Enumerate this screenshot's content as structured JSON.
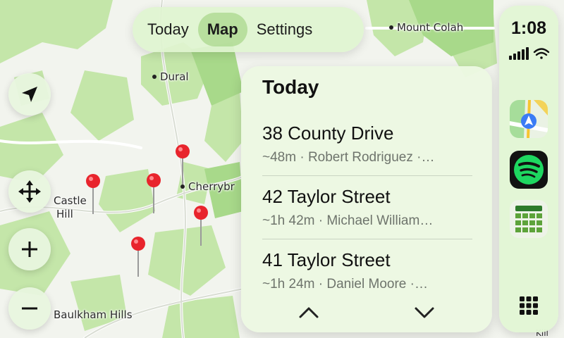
{
  "tabs": {
    "items": [
      {
        "label": "Today"
      },
      {
        "label": "Map"
      },
      {
        "label": "Settings"
      }
    ],
    "active": "Map"
  },
  "map": {
    "places": [
      "Mount Colah",
      "Dural",
      "Cherrybr",
      "Castle",
      "Hill",
      "Baulkham Hills",
      "Kill"
    ],
    "pin_color": "#e8242c",
    "pin_count": 6
  },
  "controls": {
    "locate_icon": "location-arrow-icon",
    "pan_icon": "move-arrows-icon",
    "zoom_in_icon": "plus-icon",
    "zoom_out_icon": "minus-icon"
  },
  "panel": {
    "title": "Today",
    "items": [
      {
        "title": "38 County Drive",
        "subtitle": "~48m · Robert Rodriguez ·…"
      },
      {
        "title": "42 Taylor Street",
        "subtitle": "~1h 42m · Michael William…"
      },
      {
        "title": "41 Taylor Street",
        "subtitle": "~1h 24m · Daniel Moore ·…"
      }
    ],
    "nav_icons": [
      "chevron-up-icon",
      "chevron-down-icon"
    ]
  },
  "rail": {
    "time": "1:08",
    "status_icons": [
      "signal-bars-icon",
      "wifi-icon"
    ],
    "apps": [
      "maps-app-icon",
      "spotify-app-icon",
      "grid-app-icon"
    ],
    "launcher_icon": "app-grid-icon"
  },
  "colors": {
    "accent": "#a9d68a",
    "map_green": "#bfe3a2",
    "pin": "#e8242c"
  }
}
